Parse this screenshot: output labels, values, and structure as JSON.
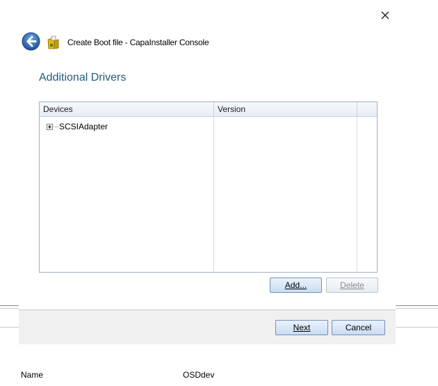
{
  "window": {
    "title": "Create Boot file - CapaInstaller Console",
    "close_icon": "close-icon",
    "back_icon": "back-arrow-icon",
    "app_icon": "capainstaller-app-icon"
  },
  "page": {
    "heading": "Additional Drivers"
  },
  "drivers_list": {
    "columns": [
      "Devices",
      "Version",
      ""
    ],
    "rows": [
      {
        "device": "SCSIAdapter",
        "version": "",
        "expander_icon": "expand-plus-icon"
      }
    ]
  },
  "list_actions": {
    "add_label": "Add...",
    "delete_label": "Delete"
  },
  "footer": {
    "next_label": "Next",
    "cancel_label": "Cancel"
  },
  "background_properties": {
    "name_label": "Name",
    "name_value": "OSDdev"
  },
  "colors": {
    "heading": "#1e5a8a",
    "button_border": "#6f8fbf",
    "footer_bg": "#f0f0f0"
  }
}
